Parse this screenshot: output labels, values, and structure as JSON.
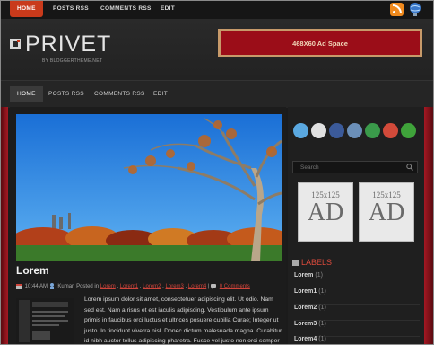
{
  "topnav": {
    "items": [
      "HOME",
      "POSTS RSS",
      "COMMENTS RSS",
      "EDIT"
    ]
  },
  "header": {
    "title": "PRIVET",
    "subtitle": "BY BLOGGERTHEME.NET",
    "ad_label": "468X60 Ad Space"
  },
  "mainnav": {
    "items": [
      "HOME",
      "POSTS RSS",
      "COMMENTS RSS",
      "EDIT"
    ]
  },
  "post": {
    "title": "Lorem",
    "time": "10:44 AM",
    "author": "Kumar",
    "posted_in": "Posted in",
    "tags": [
      "Lorem",
      "Lorem1",
      "Lorem2",
      "Lorem3",
      "Lorem4"
    ],
    "comments": "0 Comments",
    "excerpt": "Lorem ipsum dolor sit amet, consectetuer adipiscing elit. Ut odio. Nam sed est. Nam a risus et est iaculis adipiscing. Vestibulum ante ipsum primis in faucibus orci luctus et ultrices posuere cubilia Curae; Integer ut justo. In tincidunt viverra nisl. Donec dictum malesuada magna. Curabitur id nibh auctor tellus adipiscing pharetra. Fusce vel justo non orci semper feugiat."
  },
  "sidebar": {
    "social_icons": [
      "twitter-icon",
      "delicious-icon",
      "facebook-icon",
      "digg-icon",
      "stumbleupon-icon",
      "favorite-icon",
      "add-icon"
    ],
    "search_placeholder": "Search",
    "ads": [
      {
        "size": "125x125",
        "text": "AD"
      },
      {
        "size": "125x125",
        "text": "AD"
      }
    ],
    "labels_title": "LABELS",
    "labels": [
      {
        "name": "Lorem",
        "count": "(1)"
      },
      {
        "name": "Lorem1",
        "count": "(1)"
      },
      {
        "name": "Lorem2",
        "count": "(1)"
      },
      {
        "name": "Lorem3",
        "count": "(1)"
      },
      {
        "name": "Lorem4",
        "count": "(1)"
      }
    ]
  },
  "colors": {
    "accent_red": "#c93a1b",
    "link_red": "#d0443a",
    "ad_red": "#9b0d18"
  }
}
